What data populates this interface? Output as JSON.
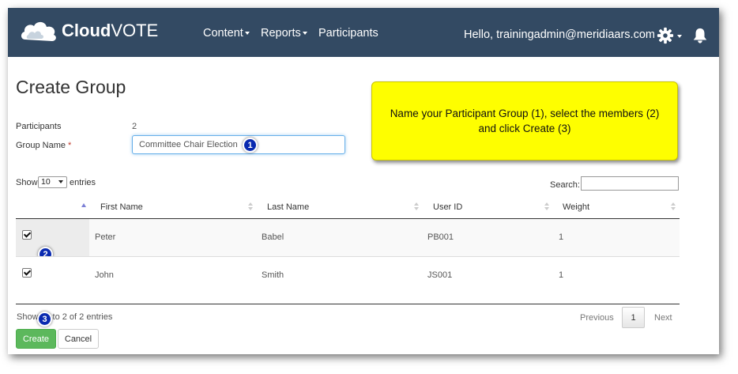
{
  "navbar": {
    "brand_bold": "Cloud",
    "brand_light": "VOTE",
    "menu": [
      {
        "label": "Content"
      },
      {
        "label": "Reports"
      },
      {
        "label": "Participants"
      }
    ],
    "greeting": "Hello, trainingadmin@meridiaars.com",
    "settings_icon": "gear-icon",
    "notifications_icon": "bell-icon"
  },
  "page": {
    "title": "Create Group",
    "participants_label": "Participants",
    "participants_count": "2",
    "group_name_label": "Group Name",
    "required_mark": "*",
    "group_name_value": "Committee Chair Election"
  },
  "callout": {
    "text": "Name your Participant Group (1), select the members (2) and click Create (3)"
  },
  "markers": [
    "1",
    "2",
    "3"
  ],
  "table_controls": {
    "show_label": "Show",
    "page_size": "10",
    "entries_label": "entries",
    "search_label": "Search:",
    "search_value": ""
  },
  "table": {
    "columns": [
      "First Name",
      "Last Name",
      "User ID",
      "Weight"
    ],
    "rows": [
      {
        "checked": true,
        "first": "Peter",
        "last": "Babel",
        "user_id": "PB001",
        "weight": "1"
      },
      {
        "checked": true,
        "first": "John",
        "last": "Smith",
        "user_id": "JS001",
        "weight": "1"
      }
    ]
  },
  "footer": {
    "info_left": "Show",
    "info_right": "to 2 of 2 entries",
    "previous": "Previous",
    "page": "1",
    "next": "Next",
    "create": "Create",
    "cancel": "Cancel"
  },
  "colors": {
    "navbar": "#334a63",
    "callout": "#fefe00",
    "create_button": "#5cb85c",
    "marker": "#0a2ab0"
  }
}
